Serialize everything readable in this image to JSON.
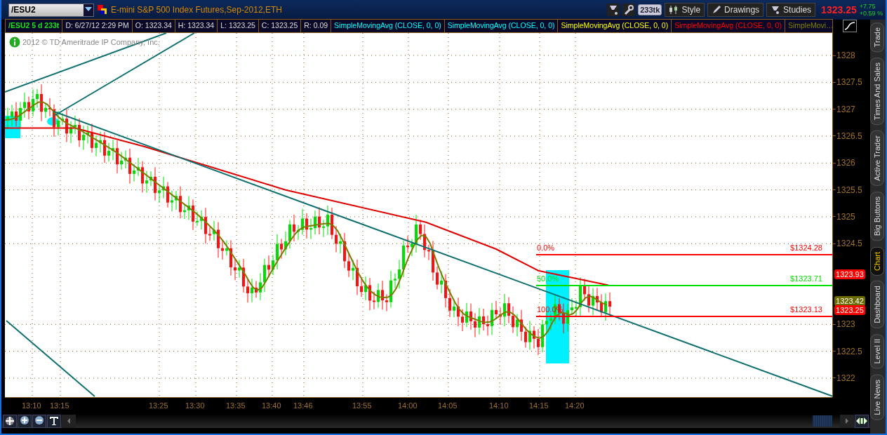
{
  "toolbar": {
    "symbol": "/ESU2",
    "instrument": "E-mini S&P 500 Index Futures,Sep-2012,ETH",
    "buttons": [
      {
        "label": "233tk",
        "kind": "chip"
      },
      {
        "label": "Style",
        "kind": "style"
      },
      {
        "label": "Drawings",
        "kind": "drawings"
      },
      {
        "label": "Studies",
        "kind": "studies"
      }
    ],
    "last_price": "1323.25",
    "change": "+7.75",
    "change_percent": "+0.59 %"
  },
  "info_bar": {
    "symbol_period": "/ESU2 5 d 233t",
    "fields": [
      "D: 6/27/12 2:29 PM",
      "O: 1323.34",
      "H: 1323.34",
      "L: 1323.25",
      "C: 1323.25",
      "R: 0.09"
    ],
    "studies": [
      {
        "label": "SimpleMovingAvg (CLOSE, 0, 0)",
        "color": "#00ffff"
      },
      {
        "label": "SimpleMovingAvg (CLOSE, 0, 0)",
        "color": "#00ffff"
      },
      {
        "label": "SimpleMovingAvg (CLOSE, 0, 0)",
        "color": "#ffff00"
      },
      {
        "label": "SimpleMovingAvg (CLOSE, 0, 0)",
        "color": "#ff0000"
      },
      {
        "label": "SimpleMovi…",
        "color": "#808000"
      }
    ]
  },
  "chart": {
    "copyright": "2012 © TD Ameritrade IP Company, Inc.",
    "price_axis": [
      "1328",
      "1327.5",
      "1327",
      "1326.5",
      "1326",
      "1325.5",
      "1325",
      "1324.5",
      "1323",
      "1322.5",
      "1322"
    ],
    "price_tags": [
      {
        "label": "1323.93",
        "color": "#ff0000"
      },
      {
        "label": "1323.42",
        "color": "#6b6b00"
      },
      {
        "label": "1323.25",
        "color": "#ff0000"
      }
    ],
    "time_axis": [
      "13:10",
      "13:15",
      "13:25",
      "13:30",
      "13:35",
      "13:40",
      "13:46",
      "13:55",
      "14:00",
      "14:05",
      "14:10",
      "14:15",
      "14:20"
    ],
    "fibonacci": [
      {
        "percent": "0.0%",
        "price": "$1324.28",
        "color": "#ff0000"
      },
      {
        "percent": "50.0%",
        "price": "$1323.71",
        "color": "#00e000"
      },
      {
        "percent": "100.0%",
        "price": "$1323.13",
        "color": "#ff0000"
      }
    ]
  },
  "side_tabs": [
    {
      "label": "Trade",
      "selected": false
    },
    {
      "label": "Times And Sales",
      "selected": false
    },
    {
      "label": "Active Trader",
      "selected": false
    },
    {
      "label": "Big Buttons",
      "selected": false
    },
    {
      "label": "Chart",
      "selected": true
    },
    {
      "label": "Dashboard",
      "selected": false
    },
    {
      "label": "Level II",
      "selected": false
    },
    {
      "label": "Live News",
      "selected": false
    }
  ]
}
